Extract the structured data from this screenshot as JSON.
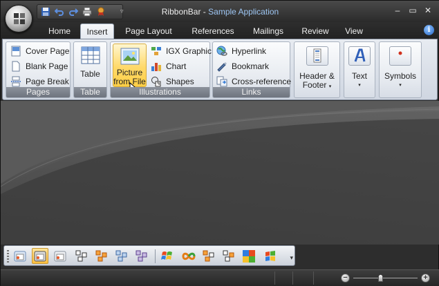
{
  "window": {
    "title_main": "RibbonBar - ",
    "title_app": "Sample Application",
    "buttons": {
      "minimize": "–",
      "restore": "▭",
      "close": "✕"
    }
  },
  "qat": {
    "icons": [
      "save-icon",
      "undo-icon",
      "redo-icon",
      "print-icon",
      "ribbon-award-icon"
    ],
    "more": "▿"
  },
  "tabs": [
    {
      "label": "Home"
    },
    {
      "label": "Insert"
    },
    {
      "label": "Page Layout"
    },
    {
      "label": "References"
    },
    {
      "label": "Mailings"
    },
    {
      "label": "Review"
    },
    {
      "label": "View"
    }
  ],
  "active_tab": "Insert",
  "help": "i",
  "ribbon": {
    "pages": {
      "label": "Pages",
      "items": [
        "Cover Page",
        "Blank Page",
        "Page Break"
      ]
    },
    "table": {
      "label": "Table",
      "button": "Table"
    },
    "illustrations": {
      "label": "Illustrations",
      "picture_line1": "Picture",
      "picture_line2": "from File",
      "items": [
        "IGX Graphic",
        "Chart",
        "Shapes"
      ]
    },
    "links": {
      "label": "Links",
      "items": [
        "Hyperlink",
        "Bookmark",
        "Cross-reference"
      ]
    },
    "header_footer": {
      "line1": "Header &",
      "line2": "Footer"
    },
    "text": {
      "label": "Text"
    },
    "symbols": {
      "label": "Symbols"
    },
    "dropdown_arrow": "▾"
  },
  "toolbar": {
    "more": "▾"
  },
  "colors": {
    "title_app": "#9dc5f2",
    "active_tab_bg": "#eef1f6",
    "hot_button": "#ffd96a",
    "group_label_bg": "#7c828c"
  }
}
